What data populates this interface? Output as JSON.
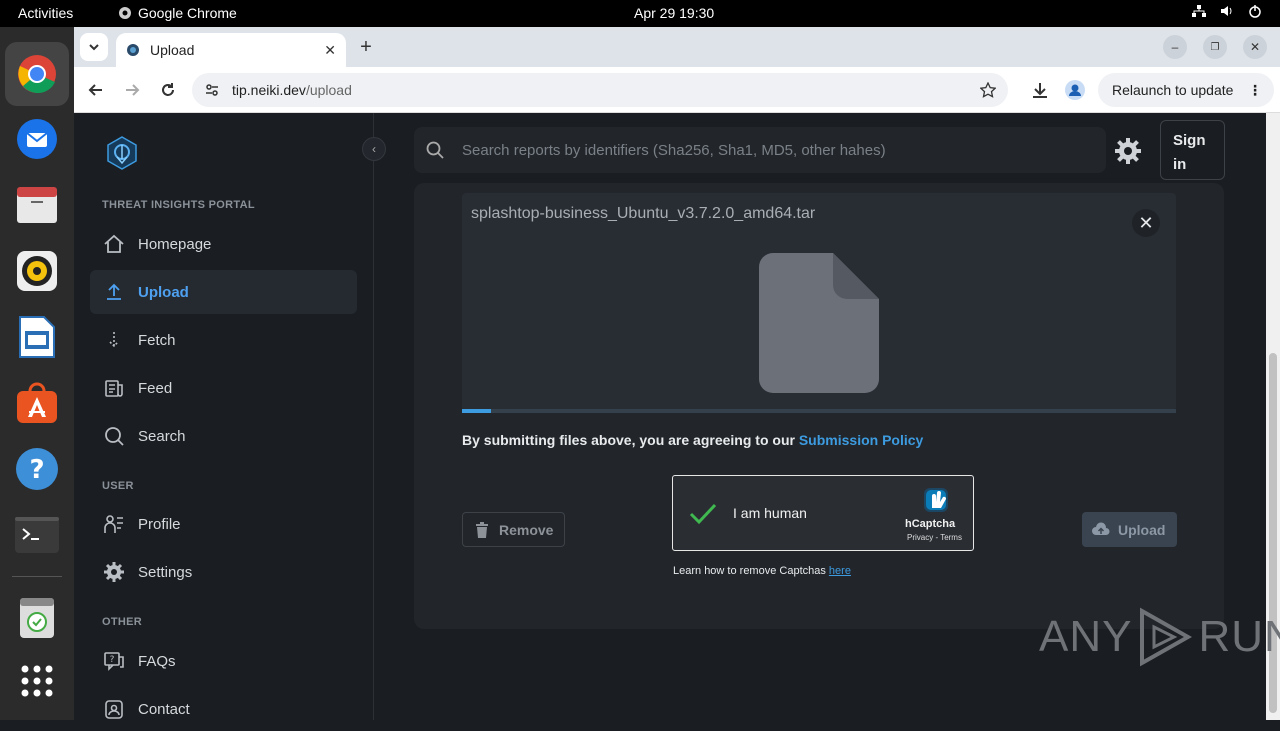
{
  "system": {
    "activities": "Activities",
    "app_name": "Google Chrome",
    "clock": "Apr 29  19:30"
  },
  "browser": {
    "tab_title": "Upload",
    "url_domain": "tip.neiki.dev",
    "url_path": "/upload",
    "relaunch_label": "Relaunch to update"
  },
  "sidebar": {
    "section_portal": "THREAT INSIGHTS PORTAL",
    "section_user": "USER",
    "section_other": "OTHER",
    "items": [
      {
        "label": "Homepage",
        "icon": "home-icon"
      },
      {
        "label": "Upload",
        "icon": "upload-icon",
        "active": true
      },
      {
        "label": "Fetch",
        "icon": "fetch-icon"
      },
      {
        "label": "Feed",
        "icon": "feed-icon"
      },
      {
        "label": "Search",
        "icon": "search-icon"
      },
      {
        "label": "Profile",
        "icon": "profile-icon"
      },
      {
        "label": "Settings",
        "icon": "settings-icon"
      },
      {
        "label": "FAQs",
        "icon": "faq-icon"
      },
      {
        "label": "Contact",
        "icon": "contact-icon"
      }
    ]
  },
  "header": {
    "search_placeholder": "Search reports by identifiers (Sha256, Sha1, MD5, other hahes)",
    "signin_label": "Sign in"
  },
  "upload": {
    "file_name": "splashtop-business_Ubuntu_v3.7.2.0_amd64.tar",
    "progress_fraction": 0.04,
    "policy_text": "By submitting files above, you are agreeing to our ",
    "policy_link": "Submission Policy",
    "remove_label": "Remove",
    "upload_label": "Upload",
    "captcha_label": "I am human",
    "captcha_brand": "hCaptcha",
    "captcha_terms": "Privacy - Terms",
    "captcha_help_text": "Learn how to remove Captchas ",
    "captcha_help_link": "here"
  },
  "watermark": {
    "left": "ANY",
    "right": "RUN"
  },
  "colors": {
    "accent": "#3d9be0",
    "background": "#1a1d21",
    "card": "#22262b"
  }
}
